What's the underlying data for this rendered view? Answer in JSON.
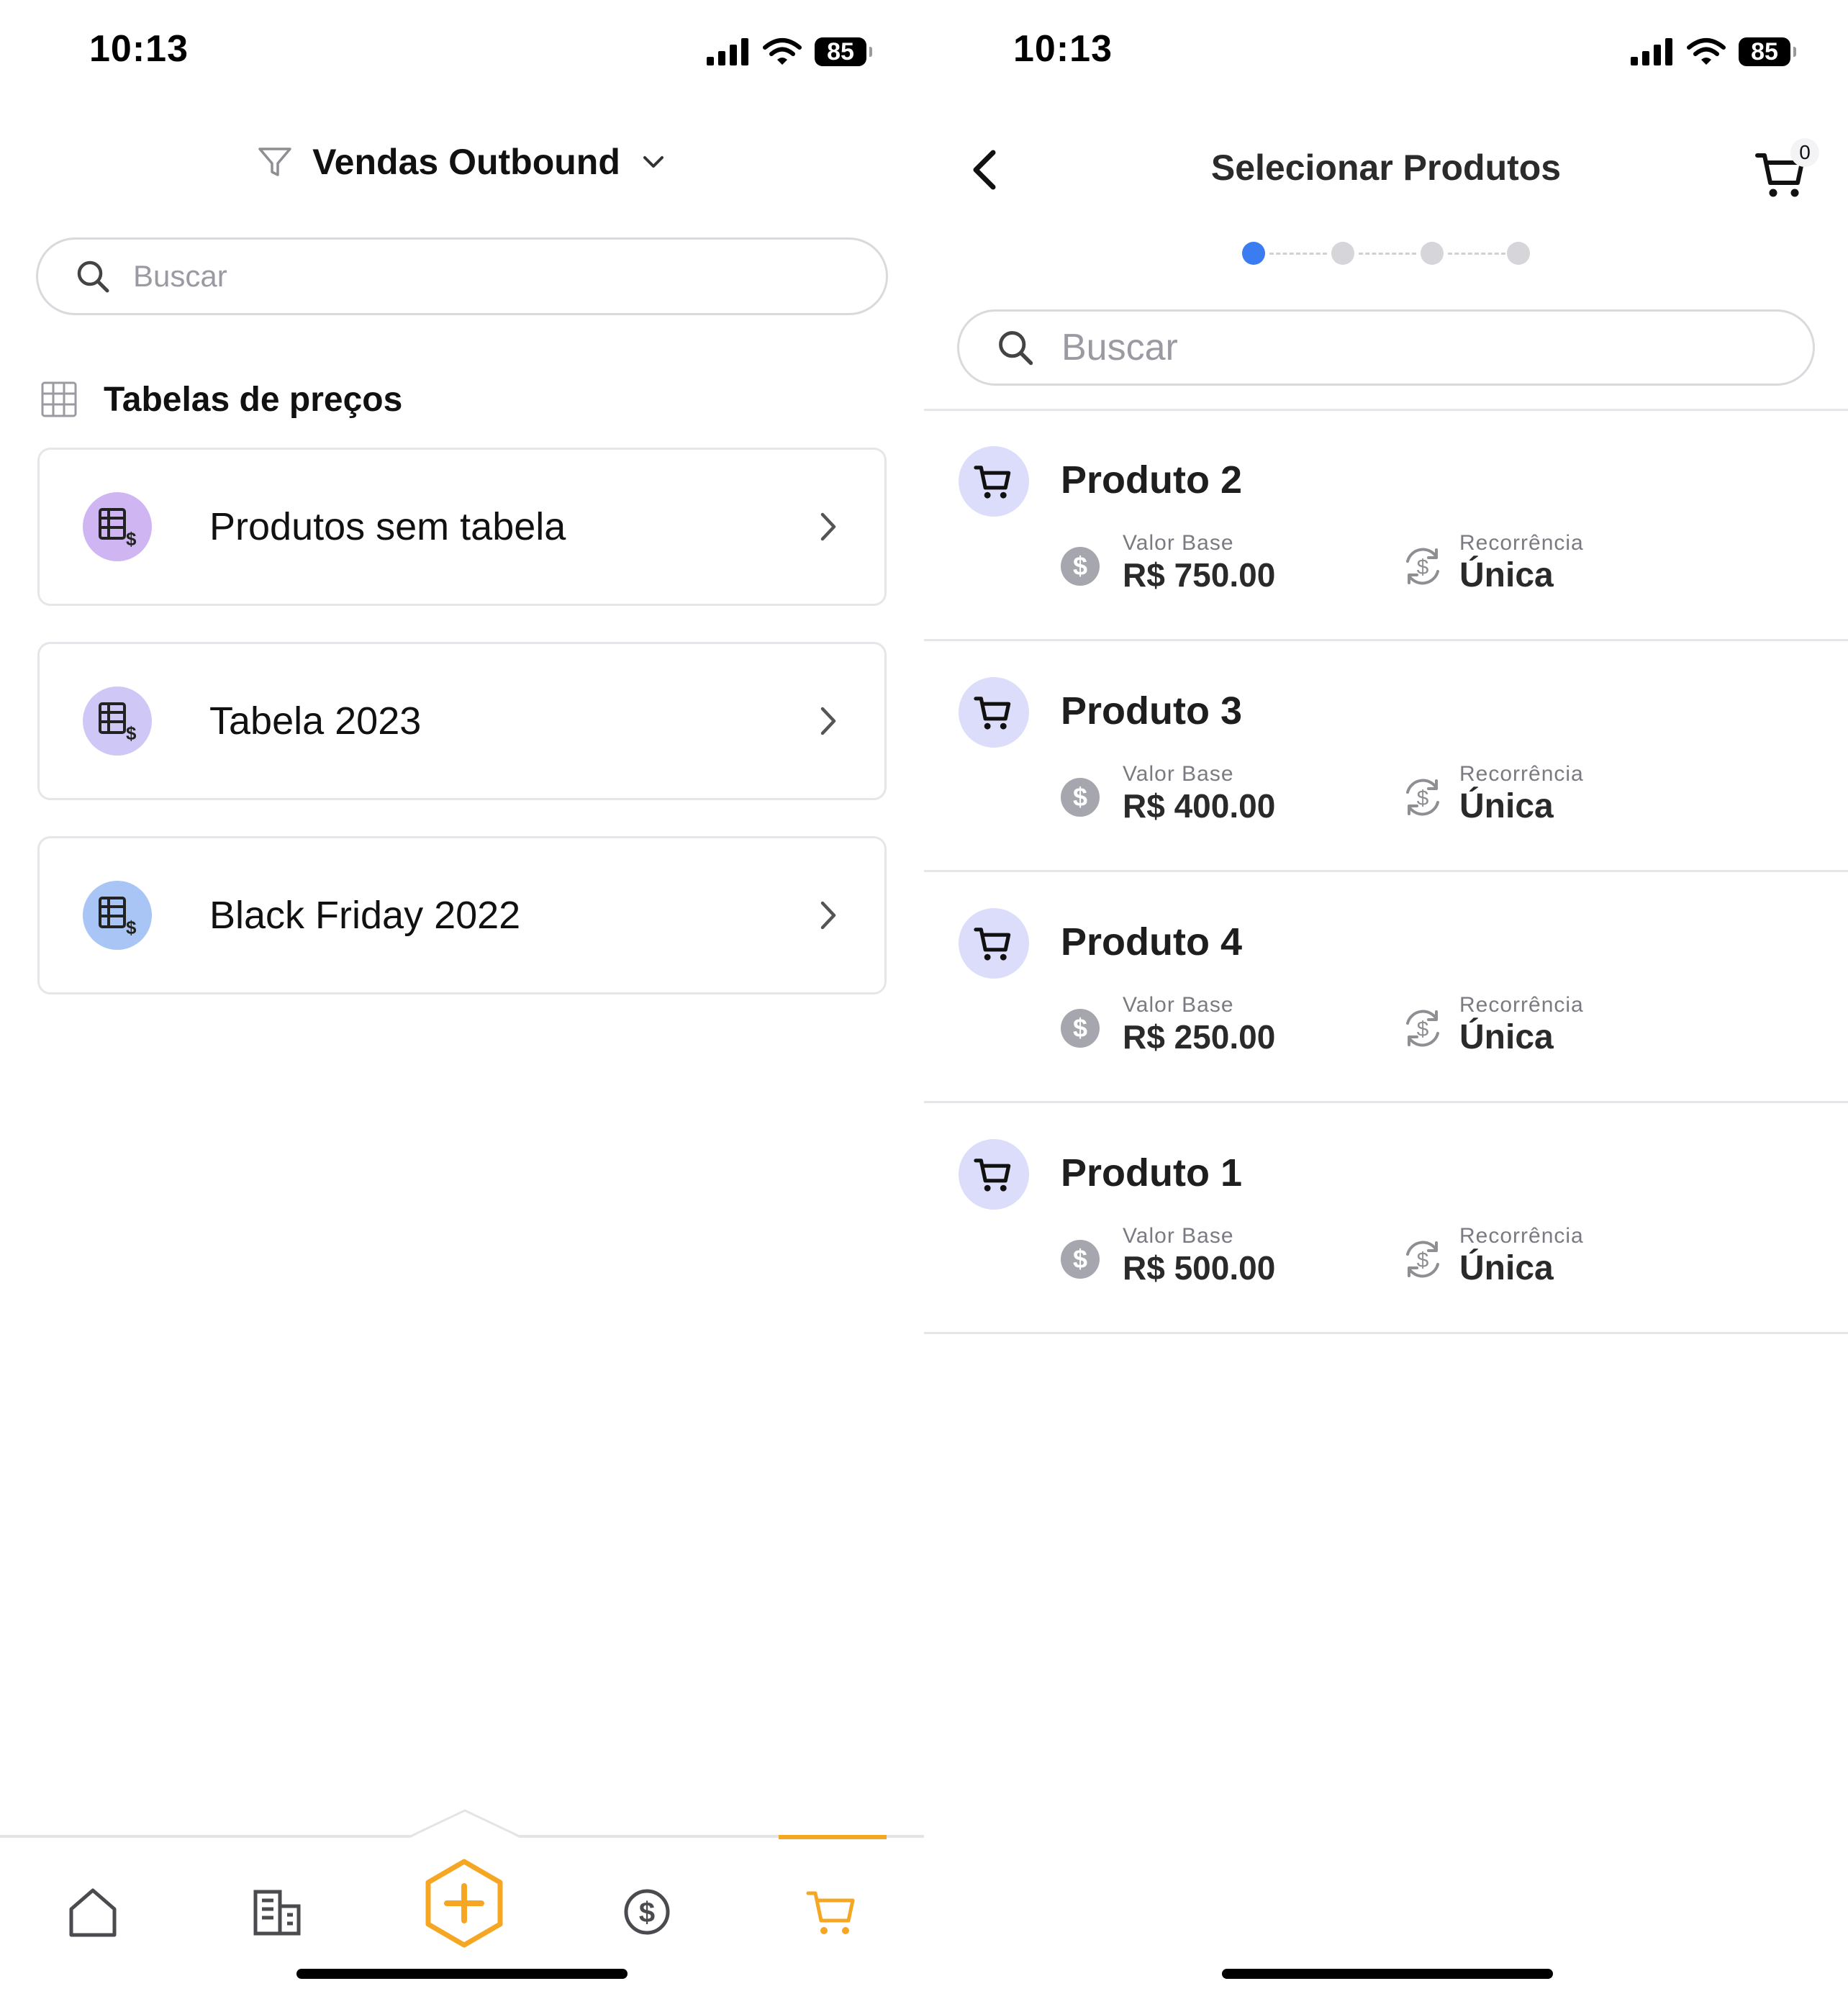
{
  "status_bar": {
    "time": "10:13",
    "battery": "85"
  },
  "left_screen": {
    "filter_title": "Vendas Outbound",
    "search": {
      "placeholder": "Buscar"
    },
    "section_title": "Tabelas de preços",
    "price_tables": [
      {
        "label": "Produtos sem tabela",
        "avatar_color": "#cfb6f2"
      },
      {
        "label": "Tabela 2023",
        "avatar_color": "#cfc8f6"
      },
      {
        "label": "Black Friday 2022",
        "avatar_color": "#a9c5f5"
      }
    ],
    "bottom_nav": {
      "items": [
        "home-icon",
        "building-icon",
        "add-icon",
        "dollar-icon",
        "cart-icon"
      ],
      "active_item": "cart-icon",
      "accent_color": "#f5a623"
    }
  },
  "right_screen": {
    "title": "Selecionar Produtos",
    "cart_count": "0",
    "steps": {
      "total": 4,
      "current": 1
    },
    "search": {
      "placeholder": "Buscar"
    },
    "products": [
      {
        "name": "Produto 2",
        "base_label": "Valor Base",
        "base_value": "R$ 750.00",
        "recurrence_label": "Recorrência",
        "recurrence_value": "Única"
      },
      {
        "name": "Produto 3",
        "base_label": "Valor Base",
        "base_value": "R$ 400.00",
        "recurrence_label": "Recorrência",
        "recurrence_value": "Única"
      },
      {
        "name": "Produto 4",
        "base_label": "Valor Base",
        "base_value": "R$ 250.00",
        "recurrence_label": "Recorrência",
        "recurrence_value": "Única"
      },
      {
        "name": "Produto 1",
        "base_label": "Valor Base",
        "base_value": "R$ 500.00",
        "recurrence_label": "Recorrência",
        "recurrence_value": "Única"
      }
    ]
  },
  "colors": {
    "accent": "#f5a623",
    "step_active": "#3b7cf0",
    "product_avatar": "#dcdcfb"
  }
}
